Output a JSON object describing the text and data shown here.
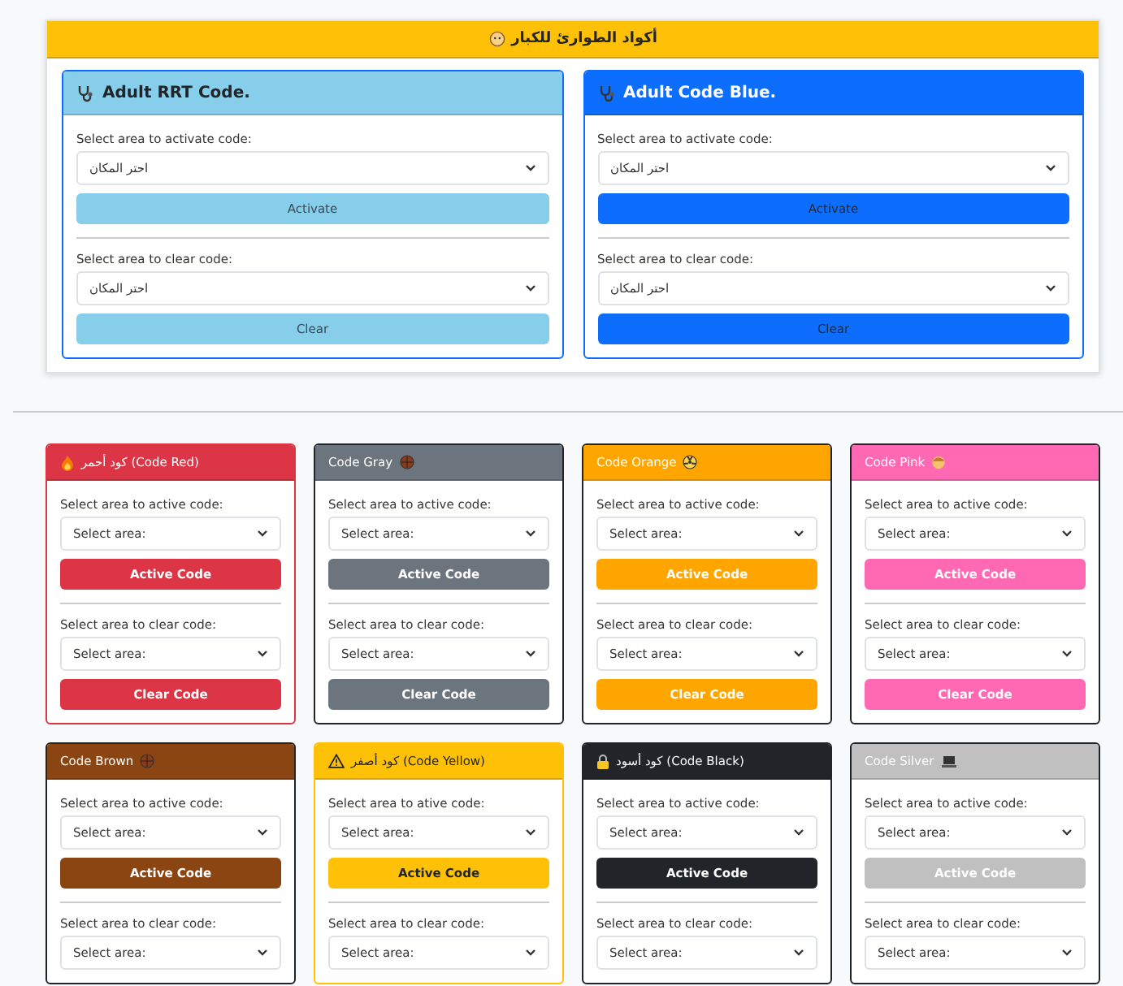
{
  "panel": {
    "title": "أكواد الطوارئ للكبار",
    "cards": [
      {
        "title": "Adult RRT Code.",
        "color": "#87ceeb",
        "sections": [
          {
            "label": "Select area to activate code:",
            "value": "احتر المكان",
            "button": "Activate"
          },
          {
            "label": "Select area to clear code:",
            "value": "احتر المكان",
            "button": "Clear"
          }
        ]
      },
      {
        "title": "Adult Code Blue.",
        "color": "#0d6efd",
        "sections": [
          {
            "label": "Select area to activate code:",
            "value": "احتر المكان",
            "button": "Activate"
          },
          {
            "label": "Select area to clear code:",
            "value": "احتر المكان",
            "button": "Clear"
          }
        ]
      }
    ]
  },
  "codes": [
    {
      "title": "كود أحمر (Code Red)",
      "color": "#dc3545",
      "sections": [
        {
          "label": "Select area to active code:",
          "value": "Select area:",
          "button": "Active Code"
        },
        {
          "label": "Select area to clear code:",
          "value": "Select area:",
          "button": "Clear Code"
        }
      ]
    },
    {
      "title": "Code Gray",
      "color": "#6c757d",
      "sections": [
        {
          "label": "Select area to active code:",
          "value": "Select area:",
          "button": "Active Code"
        },
        {
          "label": "Select area to clear code:",
          "value": "Select area:",
          "button": "Clear Code"
        }
      ]
    },
    {
      "title": "Code Orange",
      "color": "#ffa500",
      "sections": [
        {
          "label": "Select area to active code:",
          "value": "Select area:",
          "button": "Active Code"
        },
        {
          "label": "Select area to clear code:",
          "value": "Select area:",
          "button": "Clear Code"
        }
      ]
    },
    {
      "title": "Code Pink",
      "color": "#ff69b4",
      "sections": [
        {
          "label": "Select area to active code:",
          "value": "Select area:",
          "button": "Active Code"
        },
        {
          "label": "Select area to clear code:",
          "value": "Select area:",
          "button": "Clear Code"
        }
      ]
    },
    {
      "title": "Code Brown",
      "color": "#8b4513",
      "sections": [
        {
          "label": "Select area to active code:",
          "value": "Select area:",
          "button": "Active Code"
        },
        {
          "label": "Select area to clear code:",
          "value": "Select area:"
        }
      ]
    },
    {
      "title": "كود أصفر (Code Yellow)",
      "color": "#ffc107",
      "sections": [
        {
          "label": "Select area to ative code:",
          "value": "Select area:",
          "button": "Active Code"
        },
        {
          "label": "Select area to clear code:",
          "value": "Select area:"
        }
      ]
    },
    {
      "title": "كود أسود (Code Black)",
      "color": "#212529",
      "sections": [
        {
          "label": "Select area to active code:",
          "value": "Select area:",
          "button": "Active Code"
        },
        {
          "label": "Select area to clear code:",
          "value": "Select area:"
        }
      ]
    },
    {
      "title": "Code Silver",
      "color": "#c0c0c0",
      "sections": [
        {
          "label": "Select area to active code:",
          "value": "Select area:",
          "button": "Active Code"
        },
        {
          "label": "Select area to clear code:",
          "value": "Select area:"
        }
      ]
    }
  ]
}
